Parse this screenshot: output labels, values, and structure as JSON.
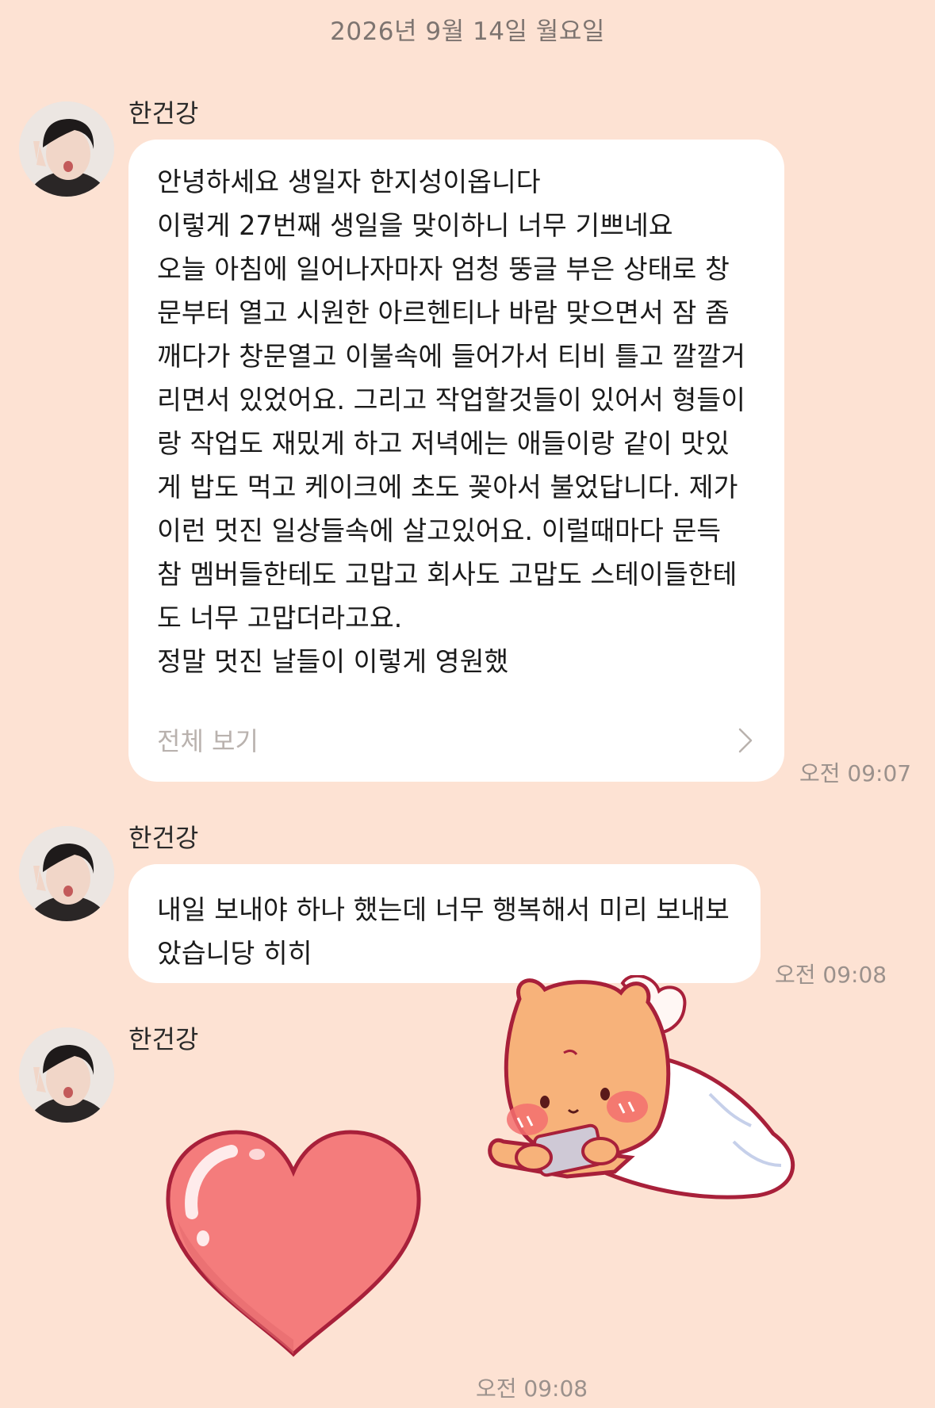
{
  "date_header": "2026년 9월 14일 월요일",
  "messages": [
    {
      "sender": "한건강",
      "lines": [
        "안녕하세요 생일자 한지성이옵니다",
        "이렇게 27번째 생일을 맞이하니 너무 기쁘네요",
        "오늘 아침에 일어나자마자 엄청 뚱글 부은 상태로 창",
        "문부터 열고 시원한 아르헨티나 바람 맞으면서 잠 좀",
        "깨다가 창문열고 이불속에 들어가서 티비 틀고 깔깔거",
        "리면서 있었어요. 그리고 작업할것들이 있어서 형들이",
        "랑 작업도 재밌게 하고 저녁에는 애들이랑 같이 맛있",
        "게 밥도 먹고 케이크에 초도 꽂아서 불었답니다. 제가",
        "이런 멋진 일상들속에 살고있어요. 이럴때마다 문득",
        "참 멤버들한테도 고맙고 회사도 고맙도 스테이들한테",
        "도 너무 고맙더라고요.",
        "정말 멋진 날들이 이렇게 영원했"
      ],
      "view_all": "전체 보기",
      "time": "오전 09:07"
    },
    {
      "sender": "한건강",
      "lines": [
        "내일 보내야 하나 했는데 너무 행복해서 미리 보내보",
        "았습니당 히히"
      ],
      "time": "오전 09:08"
    },
    {
      "sender": "한건강",
      "emoticons": [
        "heart-emoticon",
        "bear-with-phone-sticker"
      ],
      "time": "오전 09:08"
    }
  ],
  "colors": {
    "background": "#fde2d3",
    "bubble": "#ffffff",
    "heart": "#f47c7c",
    "bear": "#f7b27a"
  }
}
